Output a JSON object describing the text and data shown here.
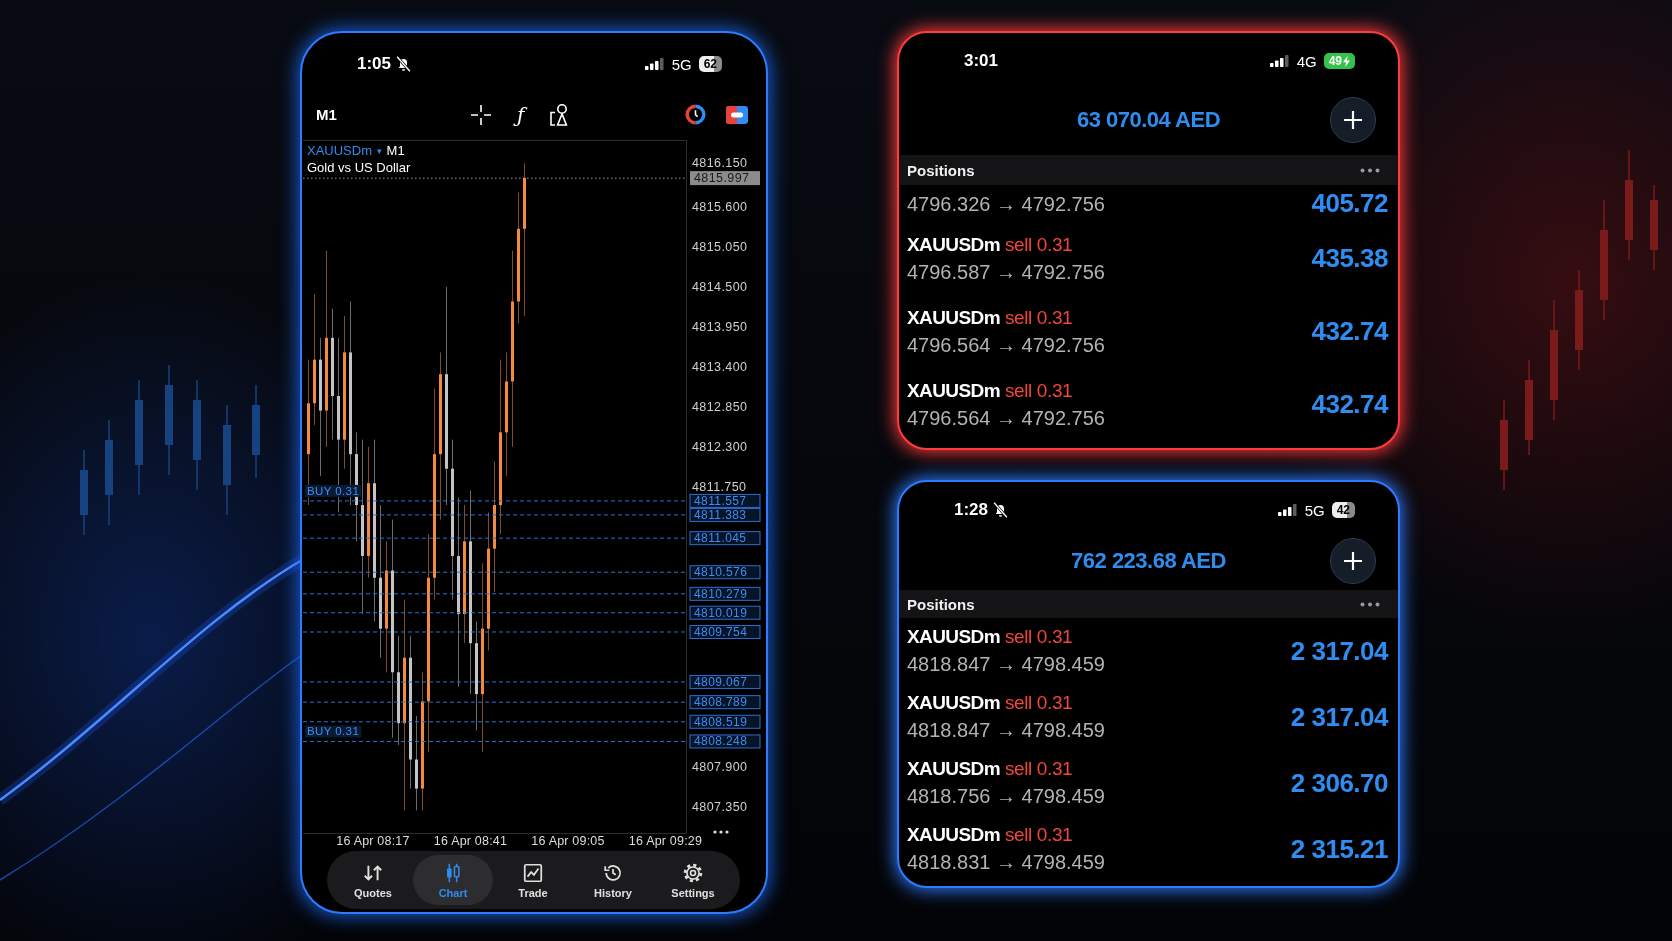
{
  "chart_phone": {
    "status_bar": {
      "time": "1:05",
      "muted": true,
      "network": "5G",
      "battery": "62",
      "charging": false
    },
    "toolbar": {
      "timeframe": "M1",
      "function_label": "ƒ"
    },
    "chart": {
      "symbol": "XAUUSDm",
      "caret": "▾",
      "timeframe": "M1",
      "description": "Gold vs US Dollar",
      "price_ticks": [
        "4816.150",
        "4815.600",
        "4815.050",
        "4814.500",
        "4813.950",
        "4813.400",
        "4812.850",
        "4812.300",
        "4811.750",
        "4807.900",
        "4807.350"
      ],
      "current_price": "4815.997",
      "positions": [
        {
          "price": "4811.557",
          "label": "BUY 0.31"
        },
        {
          "price": "4811.383"
        },
        {
          "price": "4811.045"
        },
        {
          "price": "4810.576"
        },
        {
          "price": "4810.279"
        },
        {
          "price": "4810.019"
        },
        {
          "price": "4809.754"
        },
        {
          "price": "4809.067"
        },
        {
          "price": "4808.789"
        },
        {
          "price": "4808.519"
        },
        {
          "price": "4808.248",
          "label": "BUY 0.31"
        }
      ],
      "time_labels": [
        "16 Apr 08:17",
        "16 Apr 08:41",
        "16 Apr 09:05",
        "16 Apr 09:29"
      ]
    },
    "tab_bar": [
      {
        "label": "Quotes",
        "selected": false
      },
      {
        "label": "Chart",
        "selected": true
      },
      {
        "label": "Trade",
        "selected": false
      },
      {
        "label": "History",
        "selected": false
      },
      {
        "label": "Settings",
        "selected": false
      }
    ]
  },
  "positions_cards": [
    {
      "color": "#ff3b3b",
      "status_bar": {
        "time": "3:01",
        "muted": false,
        "network": "4G",
        "battery": "49",
        "charging": true
      },
      "balance": "63 070.04 AED",
      "section_title": "Positions",
      "positions": [
        {
          "prices": "4796.326 → 4792.756",
          "profit": "405.72"
        },
        {
          "symbol": "XAUUSDm",
          "side": "sell",
          "volume": "0.31",
          "prices": "4796.587 → 4792.756",
          "profit": "435.38"
        },
        {
          "symbol": "XAUUSDm",
          "side": "sell",
          "volume": "0.31",
          "prices": "4796.564 → 4792.756",
          "profit": "432.74"
        },
        {
          "symbol": "XAUUSDm",
          "side": "sell",
          "volume": "0.31",
          "prices": "4796.564 → 4792.756",
          "profit": "432.74"
        }
      ]
    },
    {
      "color": "#2e7bff",
      "status_bar": {
        "time": "1:28",
        "muted": true,
        "network": "5G",
        "battery": "42",
        "charging": false
      },
      "balance": "762 223.68 AED",
      "section_title": "Positions",
      "positions": [
        {
          "symbol": "XAUUSDm",
          "side": "sell",
          "volume": "0.31",
          "prices": "4818.847 → 4798.459",
          "profit": "2 317.04"
        },
        {
          "symbol": "XAUUSDm",
          "side": "sell",
          "volume": "0.31",
          "prices": "4818.847 → 4798.459",
          "profit": "2 317.04"
        },
        {
          "symbol": "XAUUSDm",
          "side": "sell",
          "volume": "0.31",
          "prices": "4818.756 → 4798.459",
          "profit": "2 306.70"
        },
        {
          "symbol": "XAUUSDm",
          "side": "sell",
          "volume": "0.31",
          "prices": "4818.831 → 4798.459",
          "profit": "2 315.21"
        }
      ]
    }
  ]
}
